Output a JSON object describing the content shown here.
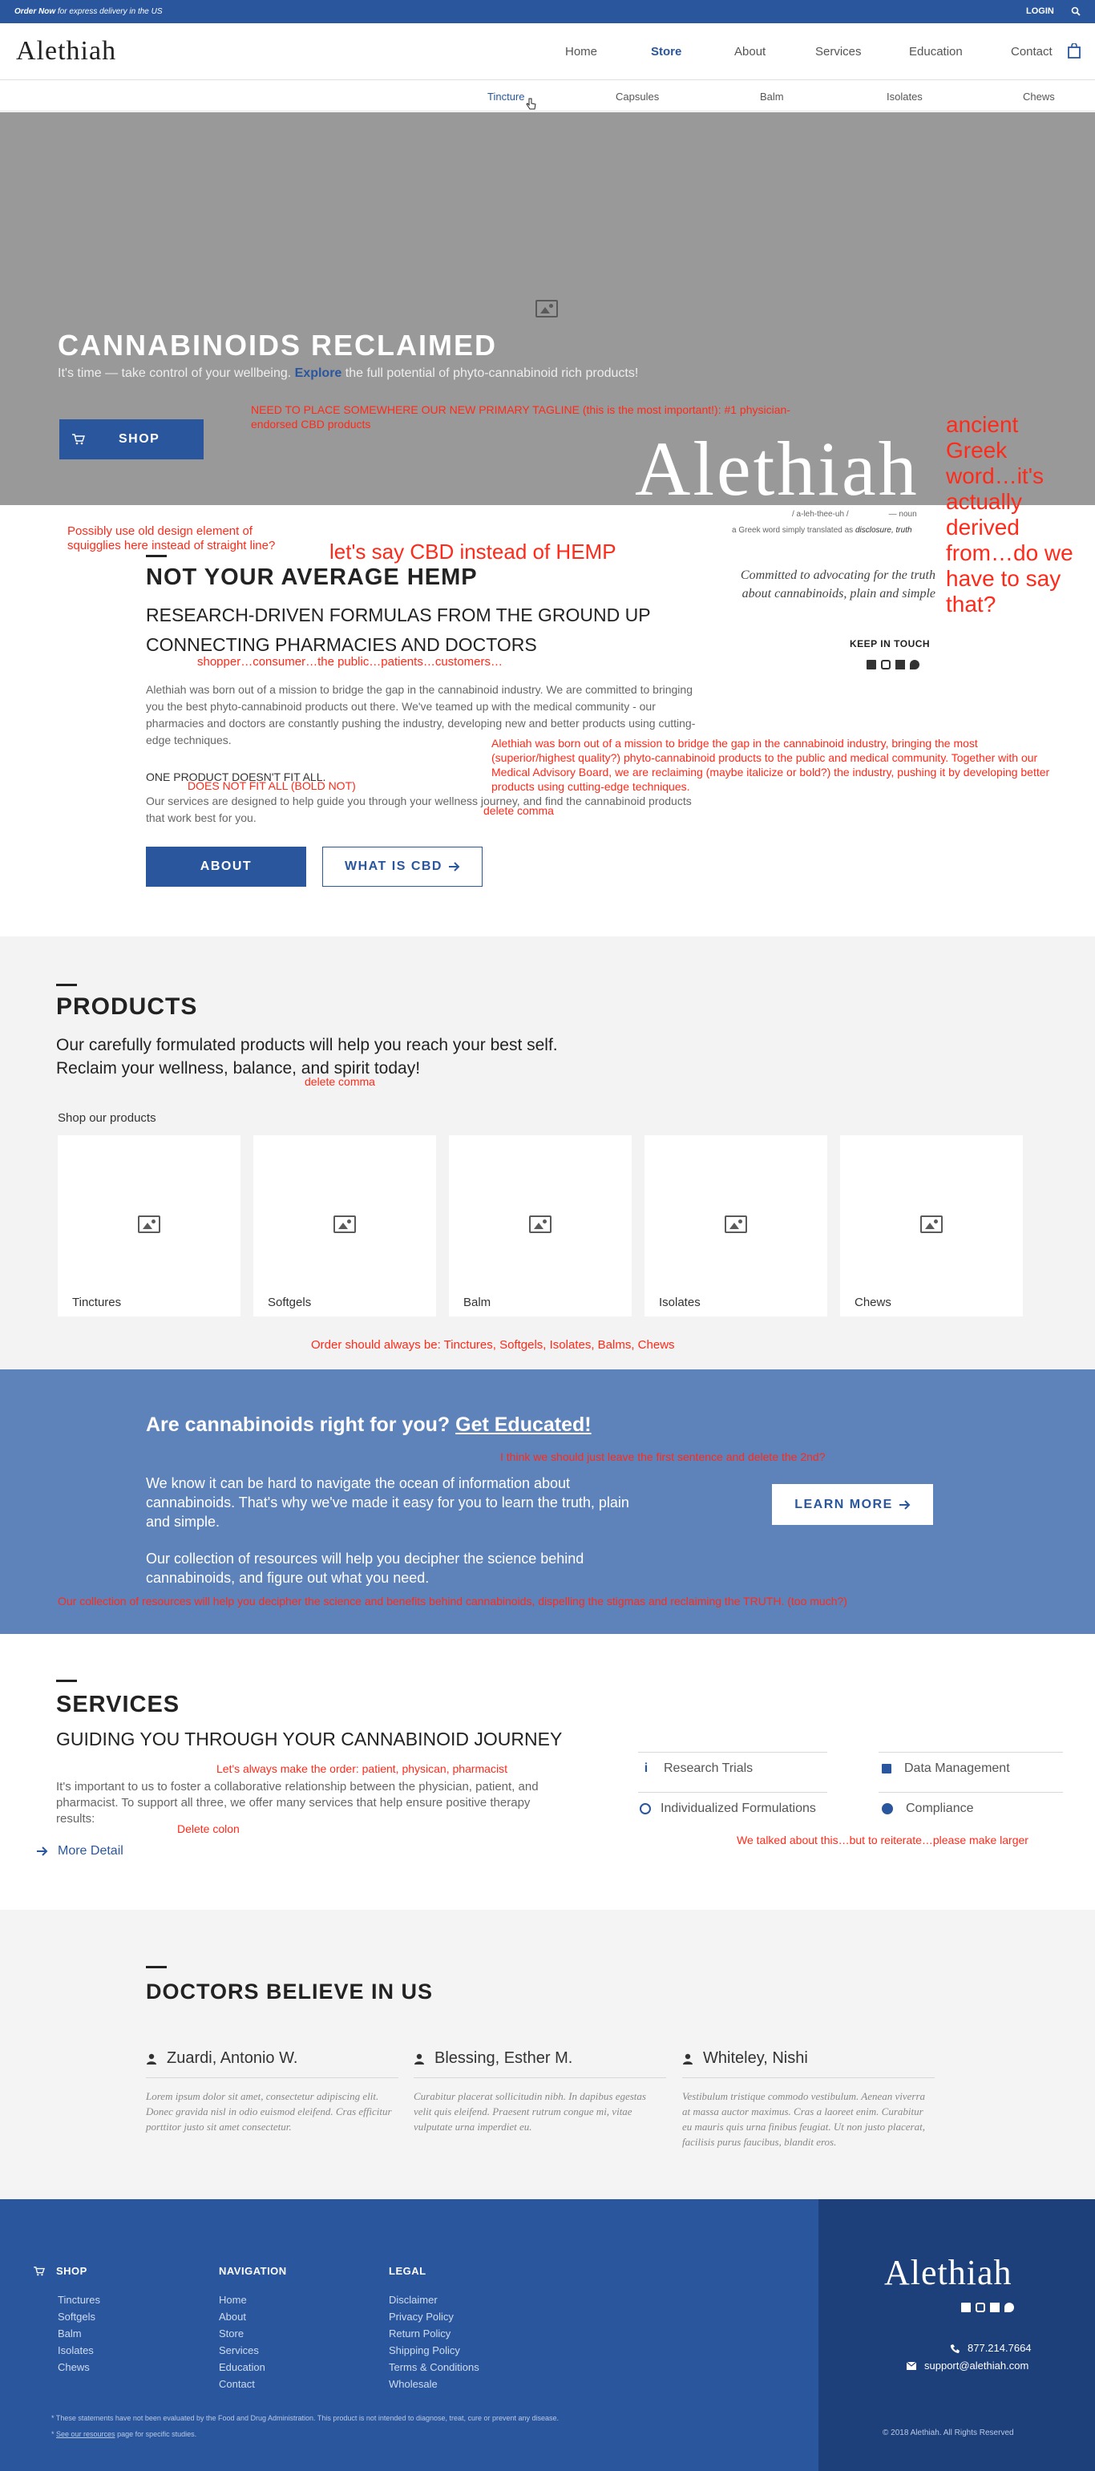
{
  "topbar": {
    "order_bold": "Order Now",
    "order_rest": " for express delivery in the US",
    "login": "LOGIN"
  },
  "header": {
    "logo": "Alethiah",
    "nav": [
      {
        "label": "Home"
      },
      {
        "label": "Store"
      },
      {
        "label": "About"
      },
      {
        "label": "Services"
      },
      {
        "label": "Education"
      },
      {
        "label": "Contact"
      }
    ]
  },
  "subnav": [
    "Tincture",
    "Capsules",
    "Balm",
    "Isolates",
    "Chews"
  ],
  "hero": {
    "title": "CANNABINOIDS RECLAIMED",
    "tagline_pre": "It's time — take control of your wellbeing. ",
    "tagline_link": "Explore",
    "tagline_post": " the full potential of phyto-cannabinoid rich products!",
    "shop_button": "SHOP",
    "watermark": "Alethiah",
    "pronounce": "/ a-leh-thee-uh /",
    "noun": "— noun",
    "greek_pre": "a Greek word simply translated as ",
    "greek_em": "disclosure, truth",
    "committed": "Committed to advocating for the truth about cannabinoids, plain and simple",
    "keep_in_touch": "KEEP IN TOUCH"
  },
  "notes": {
    "tagline_note": "NEED TO PLACE SOMEWHERE OUR NEW PRIMARY TAGLINE (this is the most important!): #1 physician-endorsed CBD products",
    "greek_note": "ancient Greek word…it's actually derived from…do we have to say that?",
    "squiggle_note": "Possibly use old design element of squigglies here instead of straight line?",
    "cbd_note": "let's say CBD instead of HEMP",
    "shopper_note": "shopper…consumer…the public…patients…customers…",
    "bold_note": "DOES NOT FIT ALL (BOLD NOT)",
    "mission_note": "Alethiah was born out of a mission to bridge the gap in the cannabinoid industry, bringing the most (superior/highest quality?) phyto-cannabinoid products to the public and medical community. Together with our Medical Advisory Board, we are reclaiming (maybe italicize or bold?) the industry, pushing it by developing better products using cutting-edge techniques.",
    "delete_comma_1": "delete comma",
    "delete_comma_2": "delete comma",
    "order_note": "Order should always be:  Tinctures, Softgels, Isolates, Balms, Chews",
    "edu_note1": "I think we should just leave the first sentence and delete the 2nd?",
    "edu_note2": "Our collection of resources will help you decipher the science and benefits behind cannabinoids, dispelling the stigmas and reclaiming the TRUTH. (too much?)",
    "order_note2": "Let's always make the order: patient, physican, pharmacist",
    "colon_note": "Delete colon",
    "larger_note": "We talked about this…but to reiterate…please make larger"
  },
  "about": {
    "title": "NOT YOUR AVERAGE HEMP",
    "sub1": "RESEARCH-DRIVEN FORMULAS FROM THE GROUND UP",
    "sub2": "CONNECTING PHARMACIES AND DOCTORS",
    "body": "Alethiah was born out of a mission to bridge the gap in the cannabinoid industry. We are committed to bringing you the best phyto-cannabinoid products out there. We've teamed up with the medical community - our pharmacies and doctors are constantly pushing the industry, developing new and better products using cutting-edge techniques.",
    "fit_title": "ONE PRODUCT DOESN'T FIT ALL.",
    "fit_body": "Our services are designed to help guide you through your wellness journey, and find the cannabinoid products that work best for you.",
    "btn_about": "ABOUT",
    "btn_cbd": "WHAT IS CBD"
  },
  "products": {
    "title": "PRODUCTS",
    "sub1": "Our carefully formulated products will help you reach your best self.",
    "sub2": "Reclaim your wellness, balance, and spirit today!",
    "shop_label": "Shop our products",
    "items": [
      "Tinctures",
      "Softgels",
      "Balm",
      "Isolates",
      "Chews"
    ]
  },
  "education": {
    "title_pre": "Are cannabinoids right for you? ",
    "title_link": "Get Educated!",
    "p1": "We know it can be hard to navigate the ocean of information about cannabinoids. That's why we've made it easy for you to learn the truth, plain and simple.",
    "p2": "Our collection of resources will help you decipher the science behind cannabinoids, and figure out what you need.",
    "button": "LEARN MORE"
  },
  "services": {
    "title": "SERVICES",
    "sub": "GUIDING YOU THROUGH YOUR CANNABINOID JOURNEY",
    "body": "It's important to us to foster a collaborative relationship between the physician, patient, and pharmacist.  To support all three, we offer many services that help ensure positive therapy results:",
    "more": "More Detail",
    "items": [
      "Research Trials",
      "Data Management",
      "Individualized Formulations",
      "Compliance"
    ]
  },
  "doctors": {
    "title": "DOCTORS BELIEVE IN US",
    "list": [
      {
        "name": "Zuardi, Antonio W.",
        "text": "Lorem ipsum dolor sit amet, consectetur adipiscing elit. Donec gravida nisl in odio euismod eleifend. Cras efficitur porttitor justo sit amet consectetur."
      },
      {
        "name": "Blessing, Esther M.",
        "text": "Curabitur placerat sollicitudin nibh. In dapibus egestas velit quis eleifend. Praesent rutrum congue mi, vitae vulputate urna imperdiet eu."
      },
      {
        "name": "Whiteley, Nishi",
        "text": "Vestibulum tristique commodo vestibulum. Aenean viverra at massa auctor maximus. Cras a laoreet enim. Curabitur eu mauris quis urna finibus feugiat. Ut non justo placerat, facilisis purus faucibus, blandit eros."
      }
    ]
  },
  "footer": {
    "shop_h": "SHOP",
    "shop": [
      "Tinctures",
      "Softgels",
      "Balm",
      "Isolates",
      "Chews"
    ],
    "nav_h": "NAVIGATION",
    "nav": [
      "Home",
      "About",
      "Store",
      "Services",
      "Education",
      "Contact"
    ],
    "legal_h": "LEGAL",
    "legal": [
      "Disclaimer",
      "Privacy Policy",
      "Return Policy",
      "Shipping Policy",
      "Terms & Conditions",
      "Wholesale"
    ],
    "disclaimer1": "* These statements have not been evaluated by the Food and Drug Administration. This product is not intended to diagnose, treat, cure or prevent any disease.",
    "disclaimer2_pre": "* ",
    "disclaimer2_link": "See our resources",
    "disclaimer2_post": " page for specific studies.",
    "logo": "Alethiah",
    "phone": "877.214.7664",
    "email": "support@alethiah.com",
    "copyright": "© 2018 Alethiah. All Rights Reserved"
  }
}
